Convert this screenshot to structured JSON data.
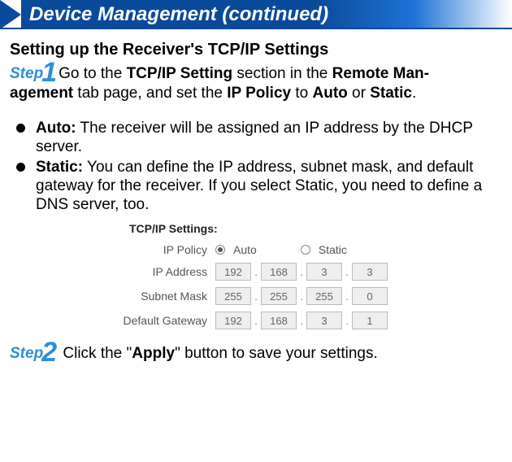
{
  "header": {
    "title": "Device Management (continued)"
  },
  "section_title": "Setting up the Receiver's TCP/IP Settings",
  "step1": {
    "label": "Step",
    "num": "1",
    "pre": "Go  to the ",
    "b1": "TCP/IP Setting",
    "mid1": " section in the ",
    "b2": "Remote Man-",
    "line2a": "agement",
    "line2b": " tab page, and set the ",
    "b3": "IP Policy",
    "line2c": " to ",
    "b4": "Auto",
    "line2d": " or ",
    "b5": "Static",
    "line2e": "."
  },
  "bullets": {
    "auto_label": "Auto:",
    "auto_text": " The receiver will be assigned an IP address by the DHCP server.",
    "static_label": "Static:",
    "static_text": " You can define the IP address, subnet mask, and default gateway for the receiver. If you select Static, you need to define a DNS server, too."
  },
  "panel": {
    "title": "TCP/IP Settings:",
    "labels": {
      "ip_policy": "IP Policy",
      "ip_address": "IP Address",
      "subnet_mask": "Subnet Mask",
      "default_gateway": "Default Gateway"
    },
    "radio": {
      "auto": "Auto",
      "static": "Static"
    },
    "ip_address": [
      "192",
      "168",
      "3",
      "3"
    ],
    "subnet_mask": [
      "255",
      "255",
      "255",
      "0"
    ],
    "default_gateway": [
      "192",
      "168",
      "3",
      "1"
    ]
  },
  "step2": {
    "label": "Step",
    "num": "2",
    "pre": " Click the \"",
    "b1": "Apply",
    "post": "\" button to save your settings."
  }
}
